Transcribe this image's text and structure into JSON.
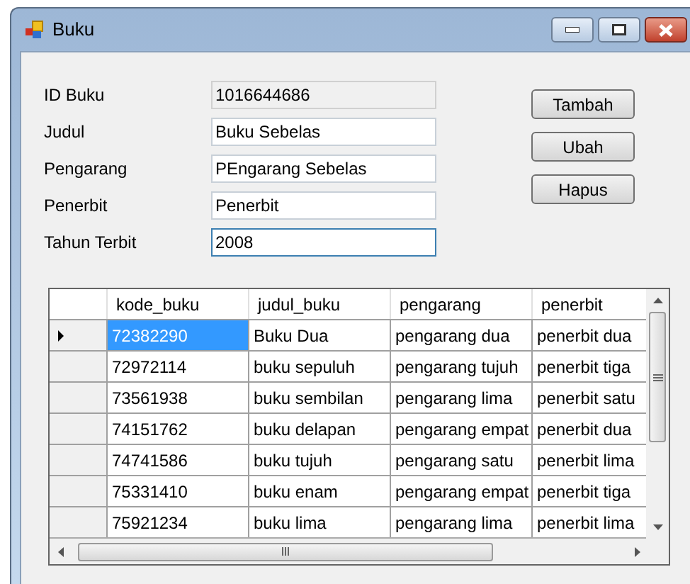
{
  "window": {
    "title": "Buku"
  },
  "fields": [
    {
      "label": "ID Buku",
      "value": "1016644686",
      "disabled": true,
      "focused": false
    },
    {
      "label": "Judul",
      "value": "Buku Sebelas",
      "disabled": false,
      "focused": false
    },
    {
      "label": "Pengarang",
      "value": "PEngarang Sebelas",
      "disabled": false,
      "focused": false
    },
    {
      "label": "Penerbit",
      "value": "Penerbit",
      "disabled": false,
      "focused": false
    },
    {
      "label": "Tahun Terbit",
      "value": "2008",
      "disabled": false,
      "focused": true
    }
  ],
  "buttons": [
    "Tambah",
    "Ubah",
    "Hapus"
  ],
  "table": {
    "columns": [
      "kode_buku",
      "judul_buku",
      "pengarang",
      "penerbit"
    ],
    "rows": [
      {
        "current": true,
        "cells": [
          {
            "text": "72382290",
            "selected": true
          },
          {
            "text": "Buku Dua",
            "selected": false
          },
          {
            "text": "pengarang dua",
            "selected": false
          },
          {
            "text": "penerbit dua",
            "selected": false
          }
        ]
      },
      {
        "current": false,
        "cells": [
          {
            "text": "72972114",
            "selected": false
          },
          {
            "text": "buku sepuluh",
            "selected": false
          },
          {
            "text": "pengarang tujuh",
            "selected": false
          },
          {
            "text": "penerbit tiga",
            "selected": false
          }
        ]
      },
      {
        "current": false,
        "cells": [
          {
            "text": "73561938",
            "selected": false
          },
          {
            "text": "buku sembilan",
            "selected": false
          },
          {
            "text": "pengarang lima",
            "selected": false
          },
          {
            "text": "penerbit satu",
            "selected": false
          }
        ]
      },
      {
        "current": false,
        "cells": [
          {
            "text": "74151762",
            "selected": false
          },
          {
            "text": "buku delapan",
            "selected": false
          },
          {
            "text": "pengarang empat",
            "selected": false
          },
          {
            "text": "penerbit dua",
            "selected": false
          }
        ]
      },
      {
        "current": false,
        "cells": [
          {
            "text": "74741586",
            "selected": false
          },
          {
            "text": "buku tujuh",
            "selected": false
          },
          {
            "text": "pengarang satu",
            "selected": false
          },
          {
            "text": "penerbit lima",
            "selected": false
          }
        ]
      },
      {
        "current": false,
        "cells": [
          {
            "text": "75331410",
            "selected": false
          },
          {
            "text": "buku enam",
            "selected": false
          },
          {
            "text": "pengarang empat",
            "selected": false
          },
          {
            "text": "penerbit tiga",
            "selected": false
          }
        ]
      },
      {
        "current": false,
        "cells": [
          {
            "text": "75921234",
            "selected": false
          },
          {
            "text": "buku lima",
            "selected": false
          },
          {
            "text": "pengarang lima",
            "selected": false
          },
          {
            "text": "penerbit lima",
            "selected": false
          }
        ]
      }
    ]
  }
}
